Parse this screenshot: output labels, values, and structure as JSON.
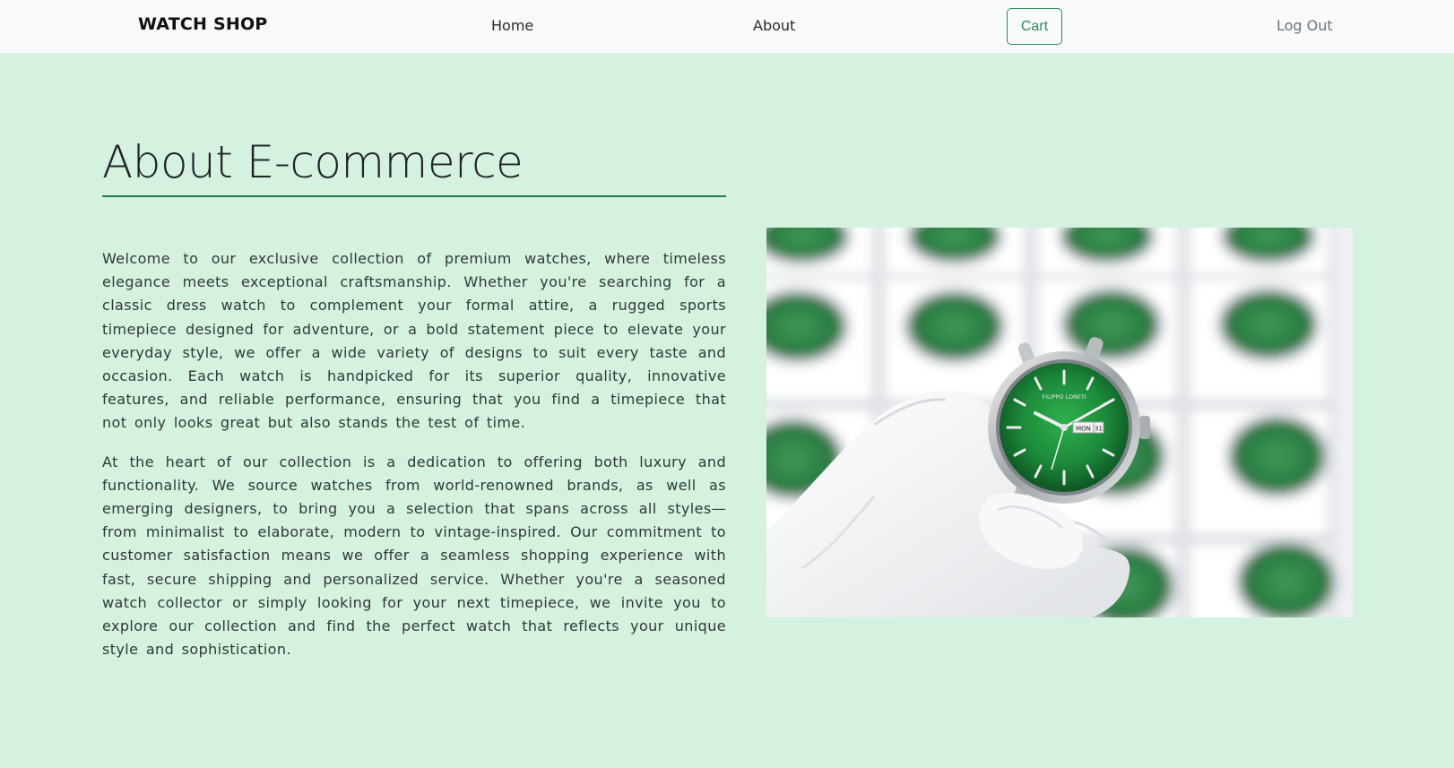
{
  "nav": {
    "brand": "WATCH SHOP",
    "home": "Home",
    "about": "About",
    "cart": "Cart",
    "logout": "Log Out"
  },
  "page": {
    "title": "About E-commerce",
    "paragraphs": [
      "Welcome to our exclusive collection of premium watches, where timeless elegance meets exceptional craftsmanship. Whether you're searching for a classic dress watch to complement your formal attire, a rugged sports timepiece designed for adventure, or a bold statement piece to elevate your everyday style, we offer a wide variety of designs to suit every taste and occasion. Each watch is handpicked for its superior quality, innovative features, and reliable performance, ensuring that you find a timepiece that not only looks great but also stands the test of time.",
      "At the heart of our collection is a dedication to offering both luxury and functionality. We source watches from world-renowned brands, as well as emerging designers, to bring you a selection that spans across all styles—from minimalist to elaborate, modern to vintage-inspired. Our commitment to customer satisfaction means we offer a seamless shopping experience with fast, secure shipping and personalized service. Whether you're a seasoned watch collector or simply looking for your next timepiece, we invite you to explore our collection and find the perfect watch that reflects your unique style and sophistication."
    ]
  },
  "image": {
    "watch_brand": "FILIPPO LORETI",
    "day": "MON",
    "date": "31"
  },
  "colors": {
    "background": "#d5f1df",
    "navbar": "#f8f9fa",
    "accent": "#2e8b57",
    "title_rule": "#1f7a55",
    "dial": "#1f8a3c"
  }
}
